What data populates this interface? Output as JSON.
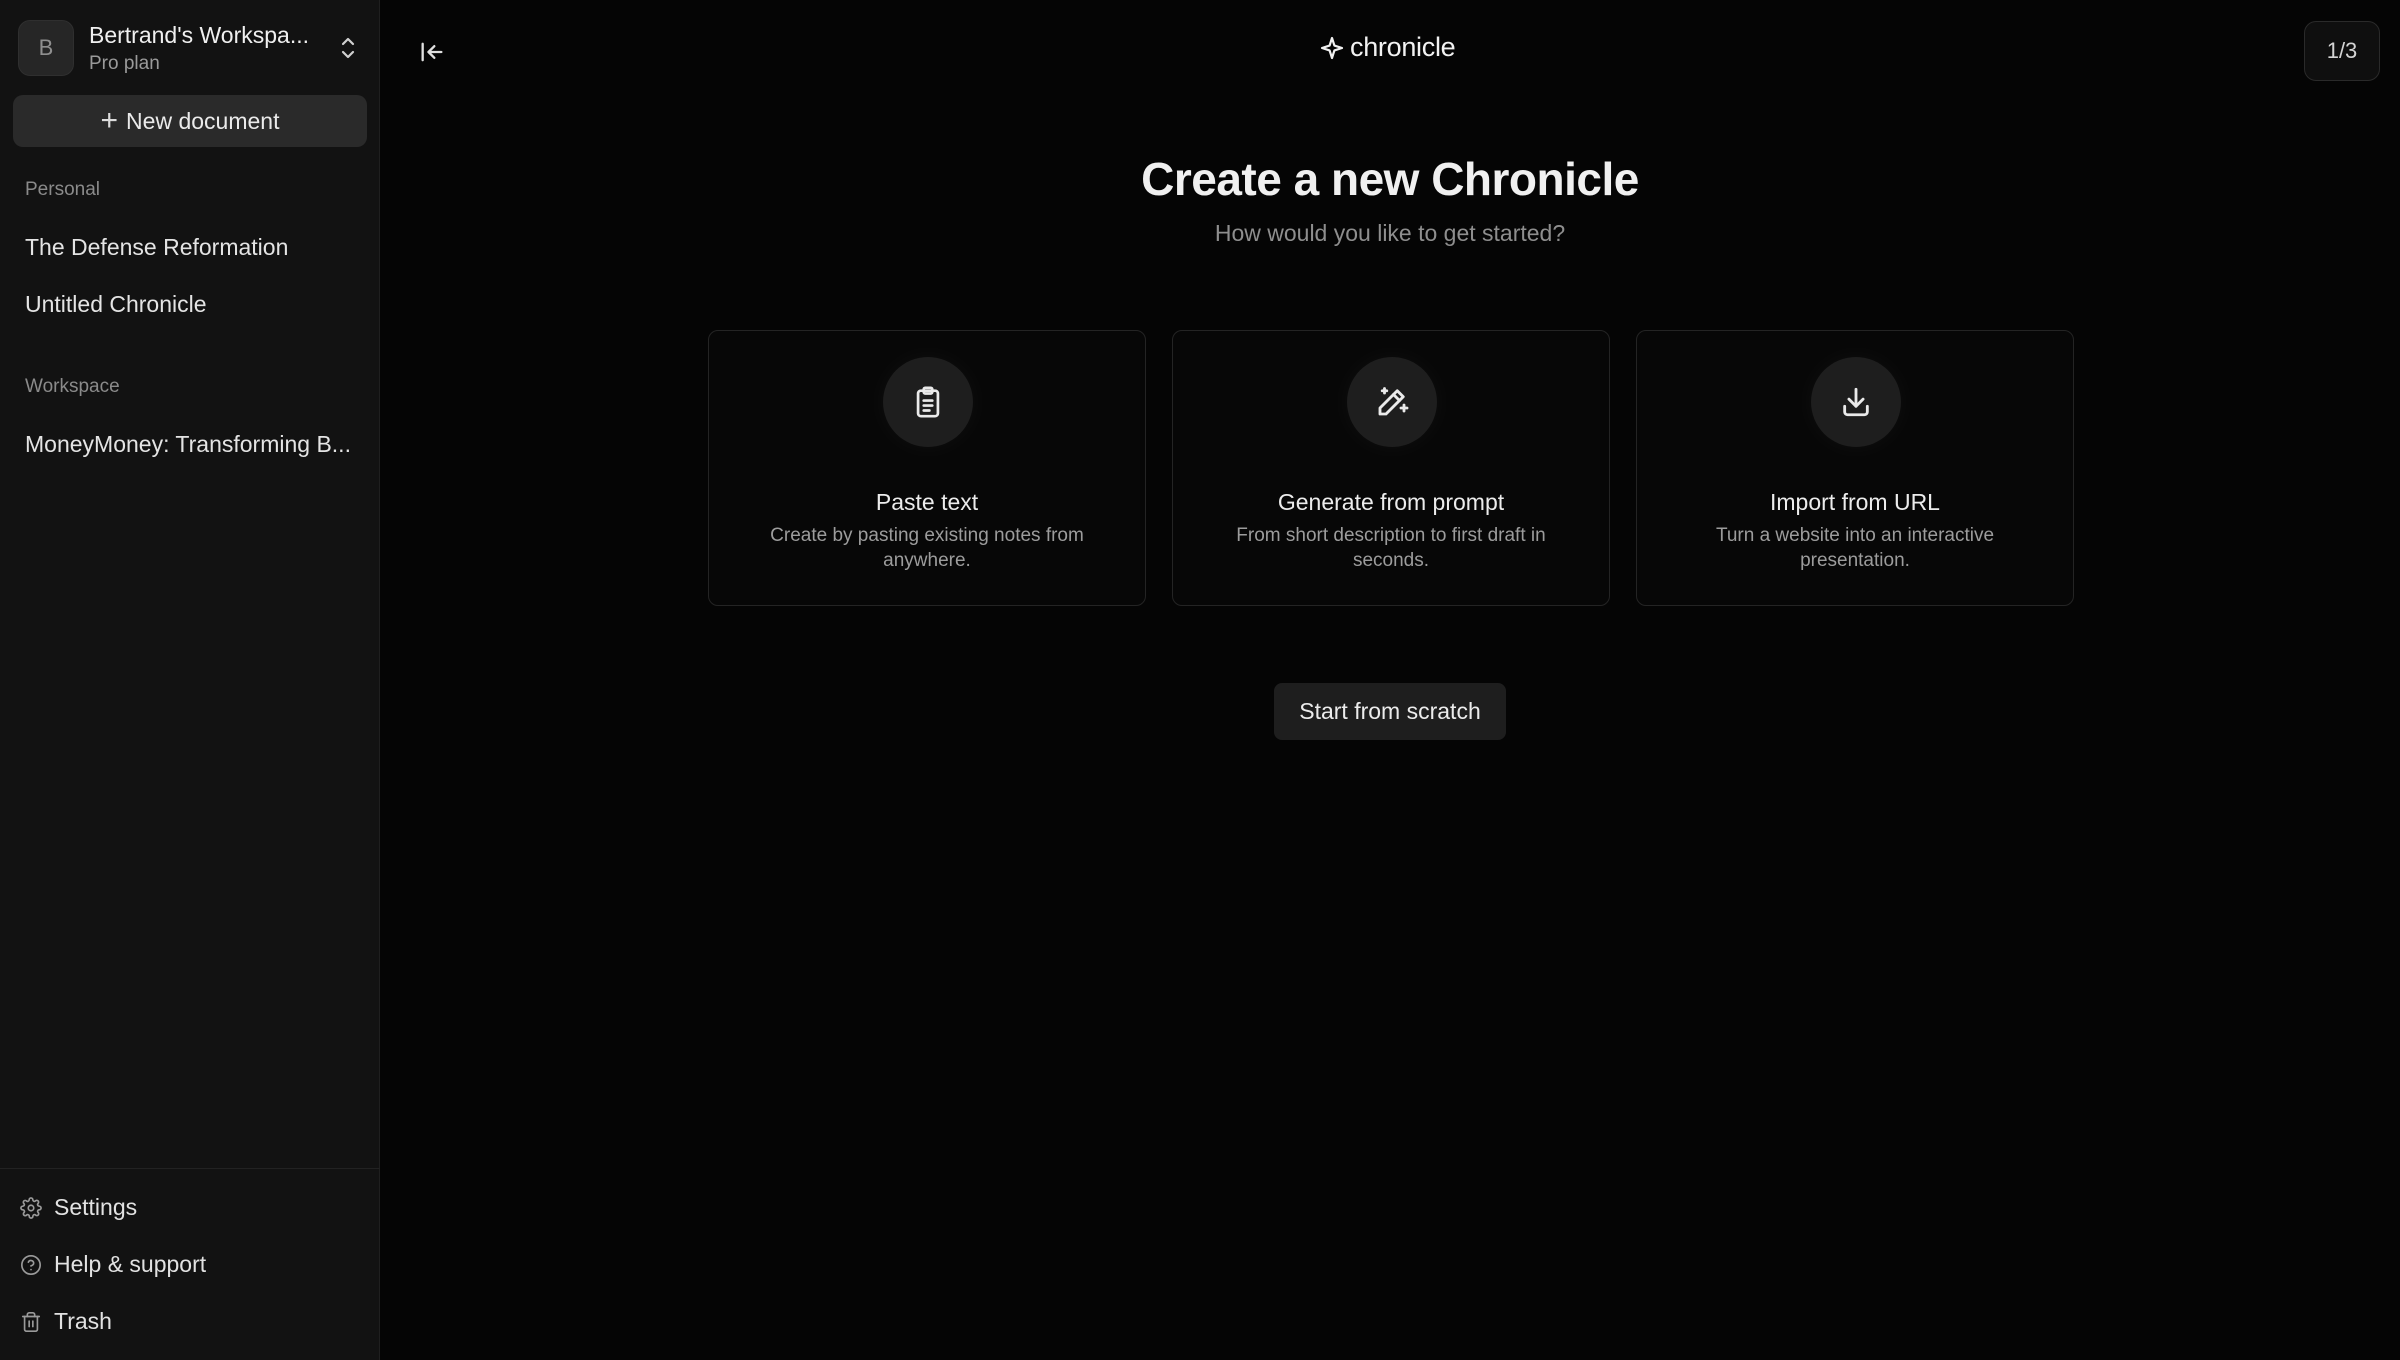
{
  "sidebar": {
    "workspace": {
      "avatar_letter": "B",
      "name": "Bertrand's Workspa...",
      "plan": "Pro plan"
    },
    "new_document_label": "New document",
    "personal": {
      "label": "Personal",
      "items": [
        {
          "title": "The Defense Reformation"
        },
        {
          "title": "Untitled Chronicle"
        }
      ]
    },
    "workspace_section": {
      "label": "Workspace",
      "items": [
        {
          "title": "MoneyMoney: Transforming B..."
        }
      ]
    },
    "footer": {
      "settings": "Settings",
      "help": "Help & support",
      "trash": "Trash"
    }
  },
  "header": {
    "brand": "chronicle",
    "page_counter": "1/3"
  },
  "main": {
    "title": "Create a new Chronicle",
    "subtitle": "How would you like to get started?",
    "options": [
      {
        "icon": "clipboard-icon",
        "title": "Paste text",
        "description": "Create by pasting existing notes from anywhere."
      },
      {
        "icon": "magic-wand-icon",
        "title": "Generate from prompt",
        "description": "From short description to first draft in seconds."
      },
      {
        "icon": "download-icon",
        "title": "Import from URL",
        "description": "Turn a website into an interactive presentation."
      }
    ],
    "start_from_scratch": "Start from scratch"
  },
  "colors": {
    "background": "#050505",
    "sidebar": "#121212",
    "card_border": "#242424",
    "button": "#2a2a2a"
  }
}
